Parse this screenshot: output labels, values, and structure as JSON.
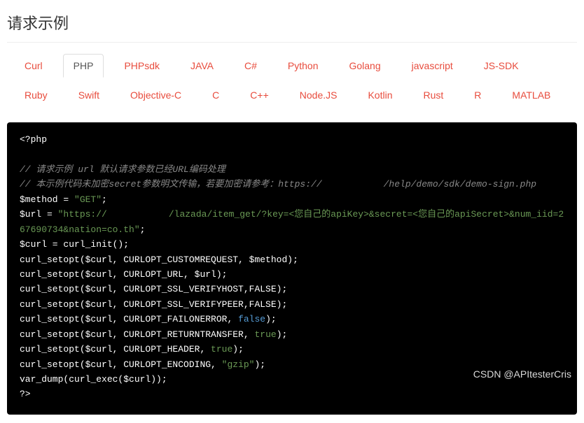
{
  "sectionTitle": "请求示例",
  "tabs": [
    {
      "label": "Curl",
      "active": false
    },
    {
      "label": "PHP",
      "active": true
    },
    {
      "label": "PHPsdk",
      "active": false
    },
    {
      "label": "JAVA",
      "active": false
    },
    {
      "label": "C#",
      "active": false
    },
    {
      "label": "Python",
      "active": false
    },
    {
      "label": "Golang",
      "active": false
    },
    {
      "label": "javascript",
      "active": false
    },
    {
      "label": "JS-SDK",
      "active": false
    },
    {
      "label": "Ruby",
      "active": false
    },
    {
      "label": "Swift",
      "active": false
    },
    {
      "label": "Objective-C",
      "active": false
    },
    {
      "label": "C",
      "active": false
    },
    {
      "label": "C++",
      "active": false
    },
    {
      "label": "Node.JS",
      "active": false
    },
    {
      "label": "Kotlin",
      "active": false
    },
    {
      "label": "Rust",
      "active": false
    },
    {
      "label": "R",
      "active": false
    },
    {
      "label": "MATLAB",
      "active": false
    }
  ],
  "code": {
    "open": "<?php",
    "comment1": "// 请求示例 url 默认请求参数已经URL编码处理",
    "comment2_a": "// 本示例代码未加密secret参数明文传输，若要加密请参考：https://",
    "comment2_b": "/help/demo/sdk/demo-sign.php",
    "method_var": "$method",
    "method_val": "\"GET\"",
    "url_var": "$url",
    "url_val_a": "\"https://",
    "url_val_b": "/lazada/item_get/?key=<您自己的apiKey>&secret=<您自己的apiSecret>&num_iid=267690734&nation=co.th\"",
    "curl_init": "$curl = curl_init();",
    "setopt1": "curl_setopt($curl, CURLOPT_CUSTOMREQUEST, $method);",
    "setopt2": "curl_setopt($curl, CURLOPT_URL, $url);",
    "setopt3": "curl_setopt($curl, CURLOPT_SSL_VERIFYHOST,FALSE);",
    "setopt4": "curl_setopt($curl, CURLOPT_SSL_VERIFYPEER,FALSE);",
    "setopt5_a": "curl_setopt($curl, CURLOPT_FAILONERROR, ",
    "setopt5_b": "false",
    "setopt5_c": ");",
    "setopt6_a": "curl_setopt($curl, CURLOPT_RETURNTRANSFER, ",
    "setopt6_b": "true",
    "setopt6_c": ");",
    "setopt7_a": "curl_setopt($curl, CURLOPT_HEADER, ",
    "setopt7_b": "true",
    "setopt7_c": ");",
    "setopt8_a": "curl_setopt($curl, CURLOPT_ENCODING, ",
    "setopt8_b": "\"gzip\"",
    "setopt8_c": ");",
    "vardump": "var_dump(curl_exec($curl));",
    "close": "?>"
  },
  "watermark": "CSDN @APItesterCris"
}
